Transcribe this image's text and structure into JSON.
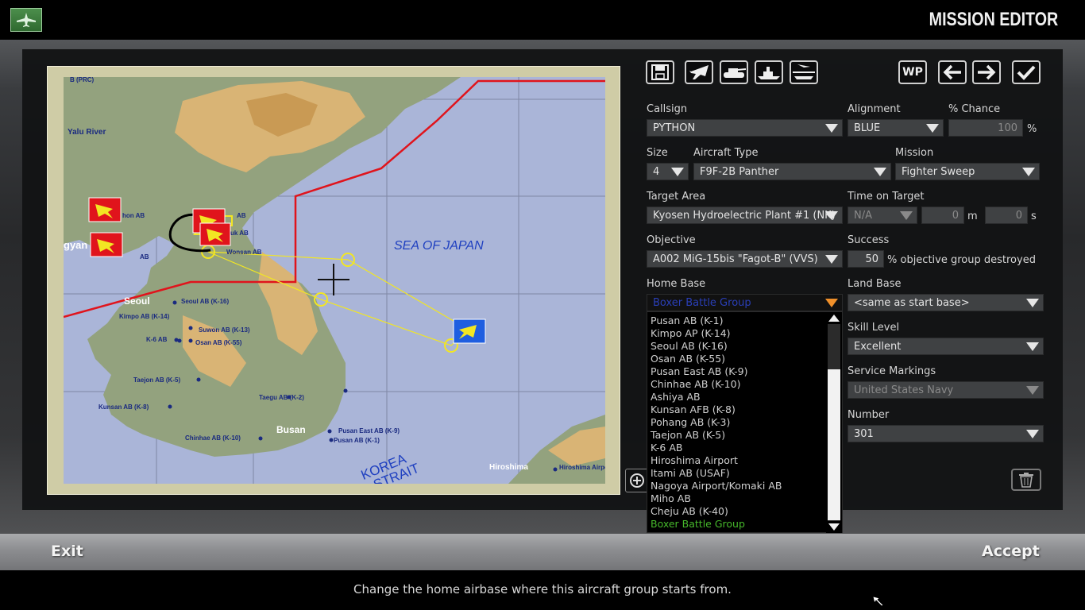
{
  "header": {
    "title": "MISSION EDITOR",
    "app_icon": "aircraft-icon"
  },
  "map": {
    "sea_label": "SEA OF JAPAN",
    "strait_label_1": "KOREA",
    "strait_label_2": "STRAIT",
    "places": {
      "yalu": "Yalu River",
      "prc": "B (PRC)",
      "seoul": "Seoul",
      "seoul_ab": "Seoul AB (K-16)",
      "kimpo": "Kimpo AB (K-14)",
      "suwon": "Suwon AB (K-13)",
      "k6": "K-6 AB",
      "osan": "Osan AB (K-55)",
      "taejon": "Taejon AB (K-5)",
      "taegu": "Taegu AB (K-2)",
      "kunsan": "Kunsan AB (K-8)",
      "chinhae": "Chinhae AB (K-10)",
      "busan": "Busan",
      "pusan_east": "Pusan East AB (K-9)",
      "pusan": "Pusan AB (K-1)",
      "hiroshima": "Hiroshima",
      "hiroshima_ap": "Hiroshima Airport",
      "pyongyang_frag": "gyan",
      "wonsan_frag": "Wonsan AB",
      "ab_frag1": "hon AB",
      "ab_frag2": "AB",
      "ab_frag3": "uk AB",
      "ab_frag4": "AB"
    },
    "colors": {
      "sea": "#aab5d8",
      "land": "#93a27e",
      "highland": "#d9b475",
      "frontline": "#e0141c",
      "route": "#f2e623",
      "enemy_marker": "#e0141c",
      "friendly_marker": "#1f5ee0"
    }
  },
  "toolbar": {
    "save": "save-icon",
    "aircraft": "aircraft-icon",
    "tank": "tank-icon",
    "ship": "ship-icon",
    "carrier": "carrier-icon",
    "waypoint": "WP",
    "prev": "arrow-left-icon",
    "next": "arrow-right-icon",
    "confirm": "checkmark-icon"
  },
  "form": {
    "callsign_label": "Callsign",
    "callsign_value": "PYTHON",
    "alignment_label": "Alignment",
    "alignment_value": "BLUE",
    "chance_label": "% Chance",
    "chance_value": "100",
    "chance_unit": "%",
    "size_label": "Size",
    "size_value": "4",
    "aircraft_type_label": "Aircraft Type",
    "aircraft_type_value": "F9F-2B Panther",
    "mission_label": "Mission",
    "mission_value": "Fighter Sweep",
    "target_area_label": "Target Area",
    "target_area_value": "Kyosen Hydroelectric Plant #1 (NK)",
    "tot_label": "Time on Target",
    "tot_value": "N/A",
    "tot_min": "0",
    "tot_min_unit": "m",
    "tot_sec": "0",
    "tot_sec_unit": "s",
    "objective_label": "Objective",
    "objective_value": "A002 MiG-15bis \"Fagot-B\" (VVS)",
    "success_label": "Success",
    "success_value": "50",
    "success_suffix": "% objective group destroyed",
    "home_base_label": "Home Base",
    "home_base_value": "Boxer Battle Group",
    "land_base_label": "Land Base",
    "land_base_value": "<same as start base>",
    "skill_label": "Skill Level",
    "skill_value": "Excellent",
    "markings_label": "Service Markings",
    "markings_value": "United States Navy",
    "number_label": "Number",
    "number_value": "301"
  },
  "home_base_options": [
    "Pusan AB (K-1)",
    "Kimpo AP (K-14)",
    "Seoul AB (K-16)",
    "Osan AB (K-55)",
    "Pusan East AB (K-9)",
    "Chinhae AB (K-10)",
    "Ashiya AB",
    "Kunsan AFB (K-8)",
    "Pohang AB (K-3)",
    "Taejon AB (K-5)",
    "K-6 AB",
    "Hiroshima Airport",
    "Itami AB (USAF)",
    "Nagoya Airport/Komaki AB",
    "Miho AB",
    "Cheju AB (K-40)",
    "Boxer Battle Group"
  ],
  "home_base_selected_index": 16,
  "footer": {
    "exit_label": "Exit",
    "accept_label": "Accept",
    "status_text": "Change the home airbase where this aircraft group starts from."
  }
}
